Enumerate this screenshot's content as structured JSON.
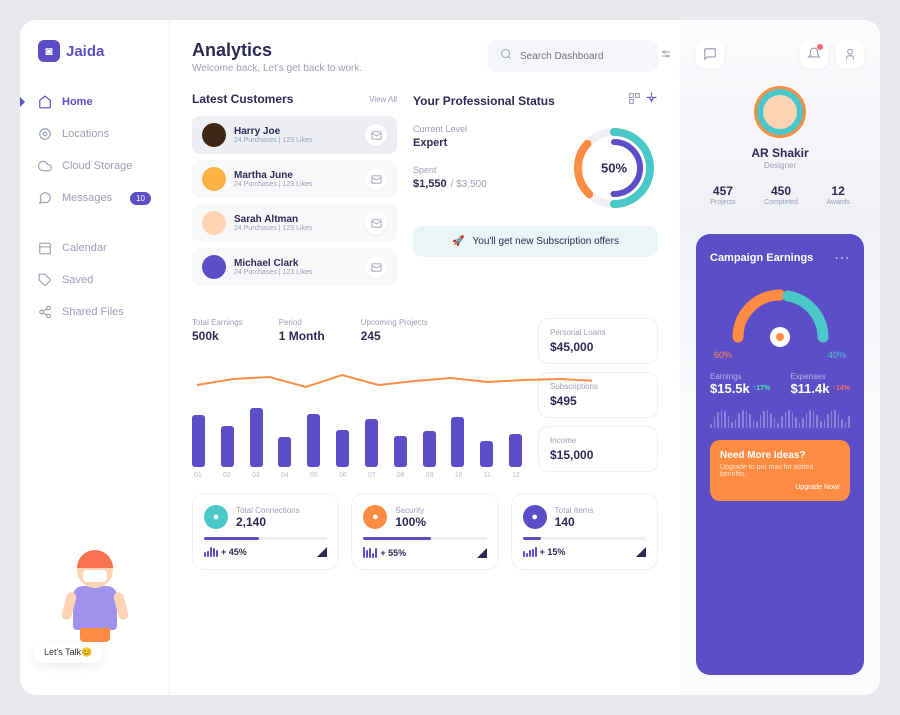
{
  "brand": "Jaida",
  "sidebar": {
    "items": [
      {
        "label": "Home",
        "active": true
      },
      {
        "label": "Locations"
      },
      {
        "label": "Cloud Storage"
      },
      {
        "label": "Messages",
        "badge": "10"
      }
    ],
    "secondary": [
      {
        "label": "Calendar"
      },
      {
        "label": "Saved"
      },
      {
        "label": "Shared Files"
      }
    ],
    "talk": "Let's Talk😊"
  },
  "header": {
    "title": "Analytics",
    "subtitle": "Welcome back, Let's get back to work.",
    "search_placeholder": "Search Dashboard"
  },
  "customers": {
    "title": "Latest Customers",
    "view_all": "View All",
    "list": [
      {
        "name": "Harry Joe",
        "meta": "24 Purchases  |  123 Likes",
        "color": "#3d2817"
      },
      {
        "name": "Martha June",
        "meta": "24 Purchases  |  123 Likes",
        "color": "#ffb347"
      },
      {
        "name": "Sarah Altman",
        "meta": "24 Purchases  |  123 Likes",
        "color": "#ffd4b5"
      },
      {
        "name": "Michael Clark",
        "meta": "24 Purchases  |  123 Likes",
        "color": "#5b4ec7"
      }
    ]
  },
  "status": {
    "title": "Your Professional Status",
    "level_label": "Current Level",
    "level": "Expert",
    "spent_label": "Spent",
    "spent": "$1,550",
    "spent_max": "/ $3,500",
    "donut": "50%",
    "notice": "You'll get new Subscription offers"
  },
  "chart": {
    "stats": [
      {
        "label": "Total Earnings",
        "value": "500k"
      },
      {
        "label": "Period",
        "value": "1 Month"
      },
      {
        "label": "Upcoming Projects",
        "value": "245"
      }
    ],
    "side": [
      {
        "label": "Personal Loans",
        "value": "$45,000"
      },
      {
        "label": "Subscriptions",
        "value": "$495"
      },
      {
        "label": "Income",
        "value": "$15,000"
      }
    ]
  },
  "chart_data": {
    "type": "bar",
    "categories": [
      "01",
      "02",
      "03",
      "04",
      "05",
      "06",
      "07",
      "08",
      "09",
      "10",
      "11",
      "12"
    ],
    "values": [
      70,
      55,
      80,
      40,
      72,
      50,
      65,
      42,
      48,
      68,
      35,
      45
    ],
    "overlay_line": [
      28,
      22,
      20,
      30,
      18,
      28,
      24,
      21,
      25,
      23,
      22,
      24
    ]
  },
  "bottom": [
    {
      "label": "Total Connections",
      "value": "2,140",
      "pct": "+ 45%",
      "color": "#4ac7c7"
    },
    {
      "label": "Security",
      "value": "100%",
      "pct": "+ 55%",
      "color": "#ff8c42"
    },
    {
      "label": "Total Items",
      "value": "140",
      "pct": "+ 15%",
      "color": "#5b4ec7"
    }
  ],
  "profile": {
    "name": "AR Shakir",
    "role": "Designer",
    "stats": [
      {
        "value": "457",
        "label": "Projects"
      },
      {
        "value": "450",
        "label": "Completed"
      },
      {
        "value": "12",
        "label": "Awards"
      }
    ]
  },
  "campaign": {
    "title": "Campaign Earnings",
    "left_pct": "60%",
    "right_pct": "40%",
    "earnings_label": "Earnings",
    "earnings": "$15.5k",
    "earnings_chg": "↑17%",
    "expenses_label": "Expenses",
    "expenses": "$11.4k",
    "expenses_chg": "↑14%",
    "promo_title": "Need More Ideas?",
    "promo_text": "Upgrade to pro max for added benefits.",
    "promo_link": "Upgrade Now!"
  }
}
